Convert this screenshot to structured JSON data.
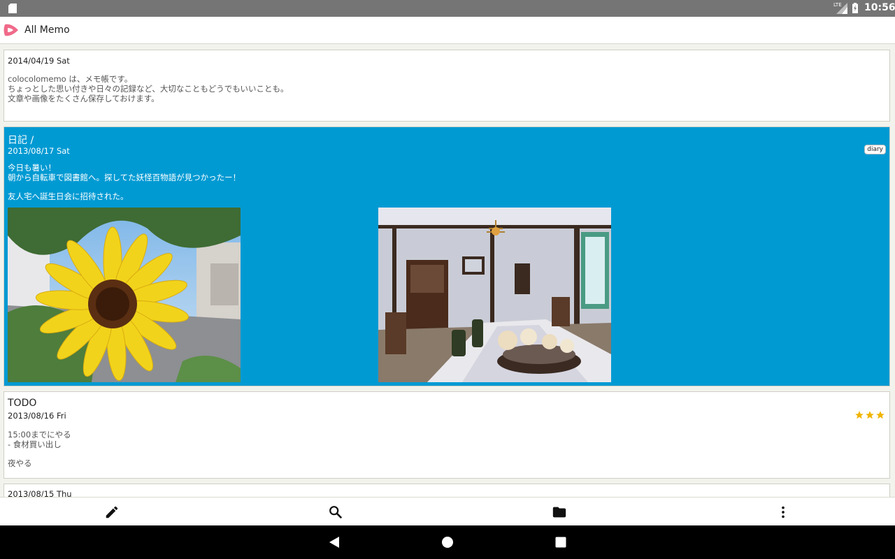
{
  "status_bar": {
    "network": "LTE",
    "time": "10:56"
  },
  "app_bar": {
    "title": "All Memo",
    "logo_icon": "colocolomemo-logo-icon"
  },
  "memos": [
    {
      "title": "",
      "date": "2014/04/19 Sat",
      "body": "colocolomemo は、メモ帳です。\nちょっとした思い付きや日々の記録など、大切なこともどうでもいいことも。\n文章や画像をたくさん保存しておけます。",
      "tag": "",
      "rating": 0,
      "selected": false
    },
    {
      "title": "日記 /",
      "date": "2013/08/17 Sat",
      "body": "今日も暑い！\n朝から自転車で図書館へ。探してた妖怪百物語が見つかったー！\n\n友人宅へ誕生日会に招待された。",
      "tag": "diary",
      "rating": 0,
      "selected": true,
      "images": [
        "sunflower-photo",
        "dining-room-photo"
      ]
    },
    {
      "title": "TODO",
      "date": "2013/08/16 Fri",
      "body": "15:00までにやる\n- 食材買い出し\n\n夜やる",
      "tag": "",
      "rating": 3,
      "selected": false
    },
    {
      "title": "",
      "date": "2013/08/15 Thu",
      "body": "",
      "tag": "",
      "rating": 0,
      "selected": false
    }
  ],
  "bottom_bar": {
    "buttons": [
      {
        "icon": "pencil-icon",
        "action": "new memo"
      },
      {
        "icon": "search-icon",
        "action": "search"
      },
      {
        "icon": "folder-icon",
        "action": "folders"
      },
      {
        "icon": "more-vert-icon",
        "action": "more"
      }
    ]
  },
  "colors": {
    "selected_card": "#009ad3",
    "status_bar": "#757575",
    "star": "#f0b400",
    "logo": "#f06a8a"
  }
}
